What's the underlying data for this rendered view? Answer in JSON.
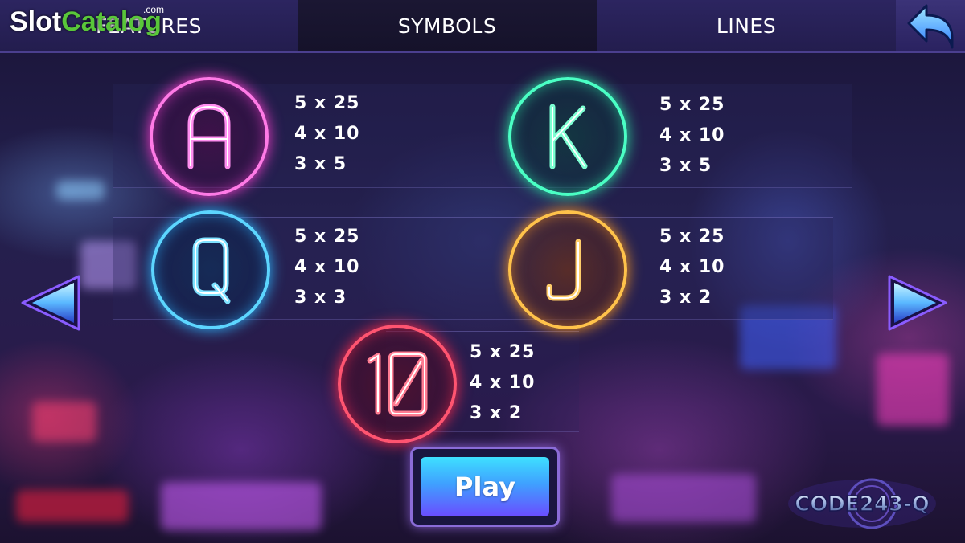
{
  "watermark": {
    "slot": "Slot",
    "catalog": "Catalog",
    "com": ".com"
  },
  "tabs": [
    {
      "label": "FEATURES",
      "active": false
    },
    {
      "label": "SYMBOLS",
      "active": true
    },
    {
      "label": "LINES",
      "active": false
    }
  ],
  "symbols": [
    {
      "name": "A",
      "color": "#ff4fd8",
      "pays": [
        "5 x 25",
        "4 x 10",
        "3 x 5"
      ]
    },
    {
      "name": "K",
      "color": "#39f2b0",
      "pays": [
        "5 x 25",
        "4 x 10",
        "3 x 5"
      ]
    },
    {
      "name": "Q",
      "color": "#3cc8ff",
      "pays": [
        "5 x 25",
        "4 x 10",
        "3 x 3"
      ]
    },
    {
      "name": "J",
      "color": "#ffae2a",
      "pays": [
        "5 x 25",
        "4 x 10",
        "3 x 2"
      ]
    },
    {
      "name": "10",
      "color": "#ff3b5c",
      "pays": [
        "5 x 25",
        "4 x 10",
        "3 x 2"
      ]
    }
  ],
  "play_label": "Play",
  "logo_text": "CODE243-Q",
  "icons": {
    "back": "back-arrow-icon",
    "prev": "left-arrow-icon",
    "next": "right-arrow-icon"
  }
}
